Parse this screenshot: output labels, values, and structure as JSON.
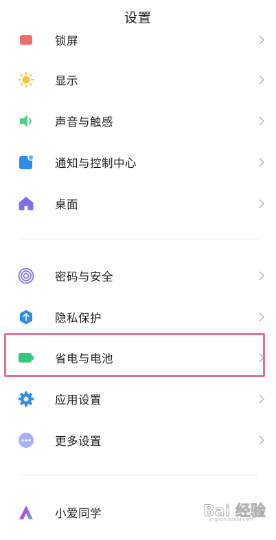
{
  "header": {
    "title": "设置"
  },
  "group1": [
    {
      "key": "lockscreen",
      "label": "锁屏",
      "icon": "lock-screen-icon",
      "color": "#f26b6b"
    },
    {
      "key": "display",
      "label": "显示",
      "icon": "sun-icon",
      "color": "#f8c437"
    },
    {
      "key": "sound",
      "label": "声音与触感",
      "icon": "speaker-icon",
      "color": "#4fd18a"
    },
    {
      "key": "notifications",
      "label": "通知与控制中心",
      "icon": "notification-icon",
      "color": "#2e8de8"
    },
    {
      "key": "desktop",
      "label": "桌面",
      "icon": "home-icon",
      "color": "#7f6fe8"
    }
  ],
  "group2": [
    {
      "key": "password",
      "label": "密码与安全",
      "icon": "fingerprint-icon",
      "color": "#8d7fe3"
    },
    {
      "key": "privacy",
      "label": "隐私保护",
      "icon": "shield-icon",
      "color": "#2e8de8"
    },
    {
      "key": "battery",
      "label": "省电与电池",
      "icon": "battery-icon",
      "color": "#32c97a"
    },
    {
      "key": "apps",
      "label": "应用设置",
      "icon": "gear-icon",
      "color": "#2e8de8"
    },
    {
      "key": "more",
      "label": "更多设置",
      "icon": "more-dots-icon",
      "color": "#a7b0f0"
    }
  ],
  "group3": [
    {
      "key": "xiaoai",
      "label": "小爱同学",
      "icon": "xiaoai-icon",
      "color": "#3a7bf2"
    }
  ],
  "watermark": {
    "text": "Bai 经验",
    "sub": "jingyan.baidu.com"
  }
}
